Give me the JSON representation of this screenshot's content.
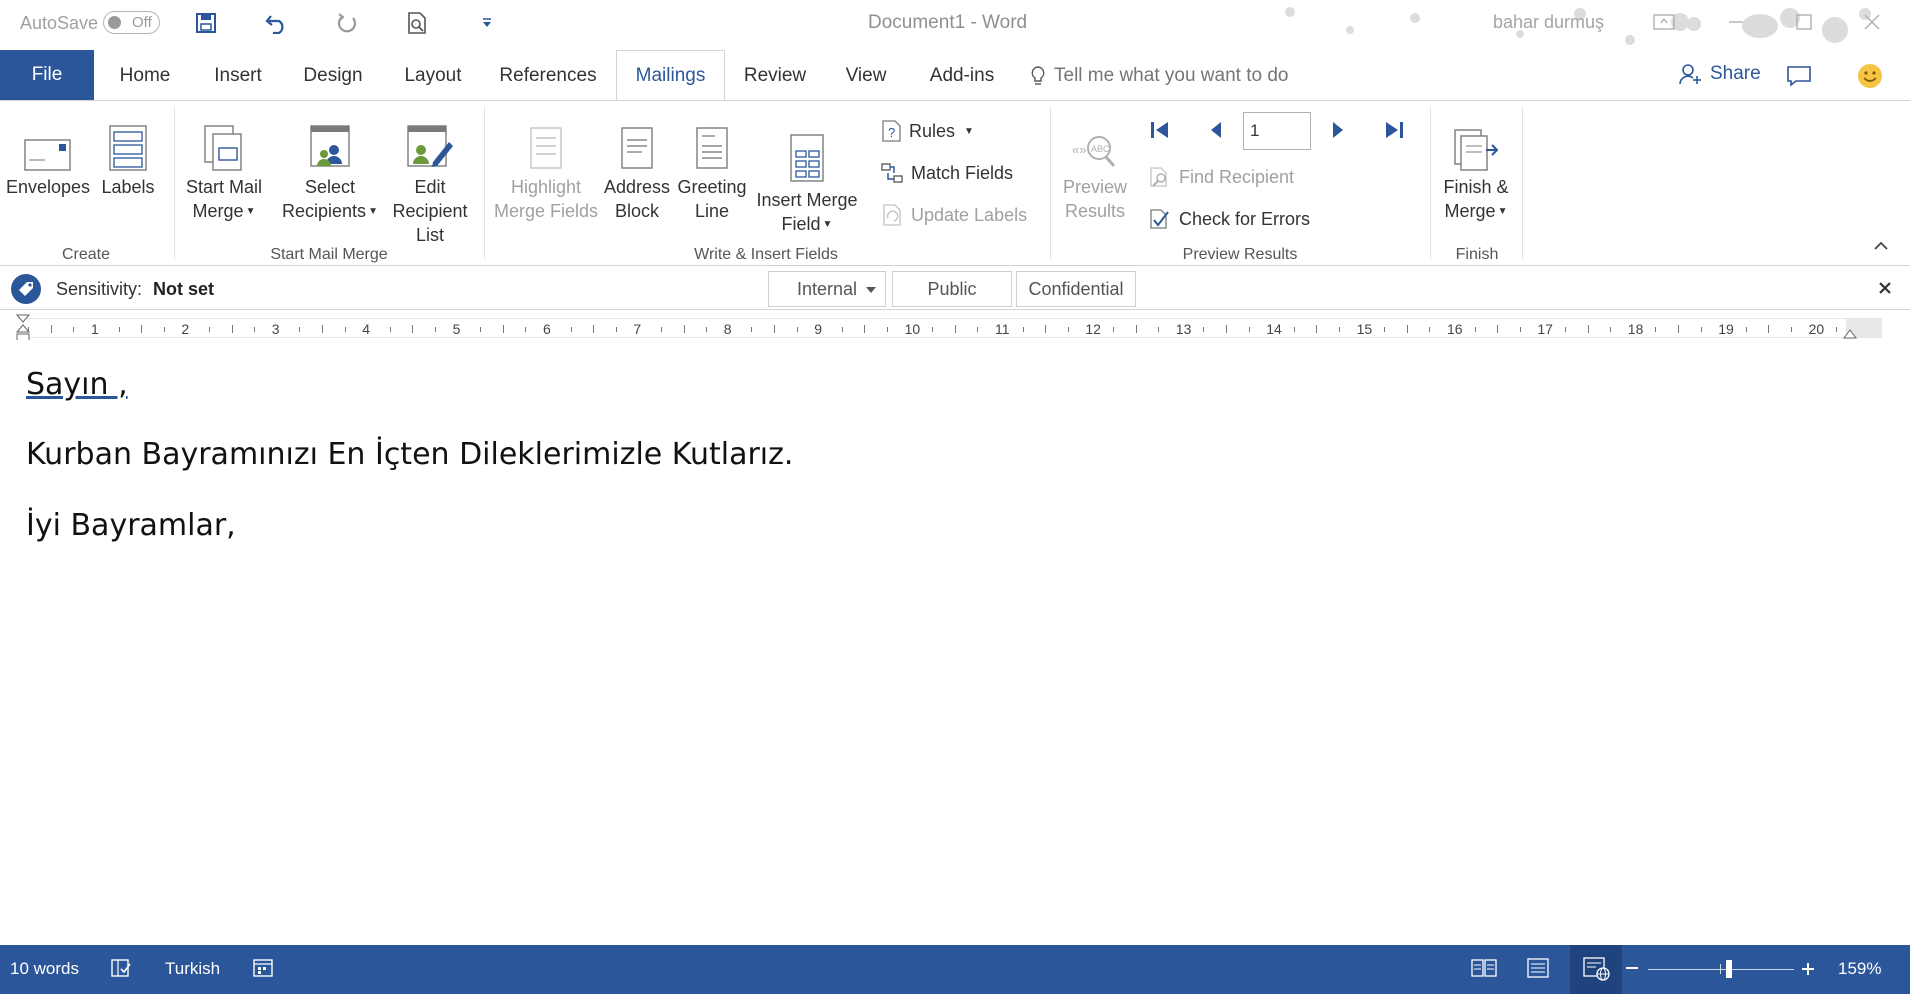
{
  "titlebar": {
    "autosave_label": "AutoSave",
    "autosave_state": "Off",
    "doc_title": "Document1  -  Word",
    "user_name": "bahar durmuş"
  },
  "tabs": {
    "file": "File",
    "items": [
      "Home",
      "Insert",
      "Design",
      "Layout",
      "References",
      "Mailings",
      "Review",
      "View",
      "Add-ins"
    ],
    "active": "Mailings",
    "tell_me": "Tell me what you want to do",
    "share": "Share"
  },
  "ribbon": {
    "create": {
      "label": "Create",
      "envelopes": "Envelopes",
      "labels": "Labels"
    },
    "start_mail_merge": {
      "label": "Start Mail Merge",
      "start_l1": "Start Mail",
      "start_l2": "Merge",
      "select_l1": "Select",
      "select_l2": "Recipients",
      "edit_l1": "Edit",
      "edit_l2": "Recipient List"
    },
    "write_insert": {
      "label": "Write & Insert Fields",
      "highlight_l1": "Highlight",
      "highlight_l2": "Merge Fields",
      "address_l1": "Address",
      "address_l2": "Block",
      "greeting_l1": "Greeting",
      "greeting_l2": "Line",
      "insert_l1": "Insert Merge",
      "insert_l2": "Field",
      "rules": "Rules",
      "match_fields": "Match Fields",
      "update_labels": "Update Labels"
    },
    "preview": {
      "label": "Preview Results",
      "preview_l1": "Preview",
      "preview_l2": "Results",
      "record": "1",
      "find_recipient": "Find Recipient",
      "check_errors": "Check for Errors"
    },
    "finish": {
      "label": "Finish",
      "finish_l1": "Finish &",
      "finish_l2": "Merge"
    }
  },
  "sensitivity": {
    "label": "Sensitivity:",
    "value": "Not set",
    "options": [
      "Internal",
      "Public",
      "Confidential"
    ]
  },
  "ruler": {
    "numbers": [
      "1",
      "2",
      "3",
      "4",
      "5",
      "6",
      "7",
      "8",
      "9",
      "10",
      "11",
      "12",
      "13",
      "14",
      "15",
      "16",
      "17",
      "18",
      "19",
      "20"
    ]
  },
  "document": {
    "paragraphs": [
      "Sayın ,",
      "Kurban Bayramınızı En İçten Dileklerimizle Kutlarız.",
      "İyi Bayramlar,"
    ]
  },
  "statusbar": {
    "words": "10 words",
    "language": "Turkish",
    "zoom": "159%"
  },
  "colors": {
    "accent": "#2b579a",
    "statusbar": "#2b579a"
  }
}
